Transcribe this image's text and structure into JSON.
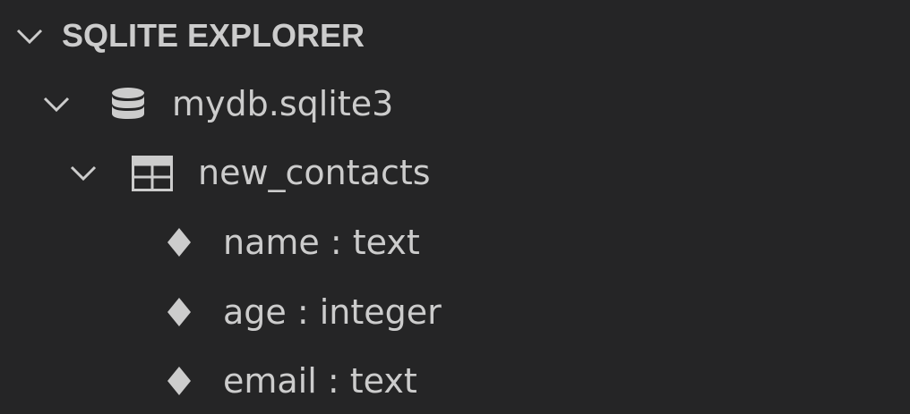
{
  "explorer": {
    "title": "SQLITE EXPLORER",
    "title_expanded": true
  },
  "database": {
    "name": "mydb.sqlite3",
    "icon": "database-icon",
    "expanded": true
  },
  "table": {
    "name": "new_contacts",
    "icon": "table-icon",
    "expanded": true
  },
  "columns": [
    {
      "label": "name : text",
      "icon": "column-diamond-icon"
    },
    {
      "label": "age : integer",
      "icon": "column-diamond-icon"
    },
    {
      "label": "email : text",
      "icon": "column-diamond-icon"
    }
  ],
  "colors": {
    "background": "#252526",
    "foreground": "#cccccc"
  }
}
